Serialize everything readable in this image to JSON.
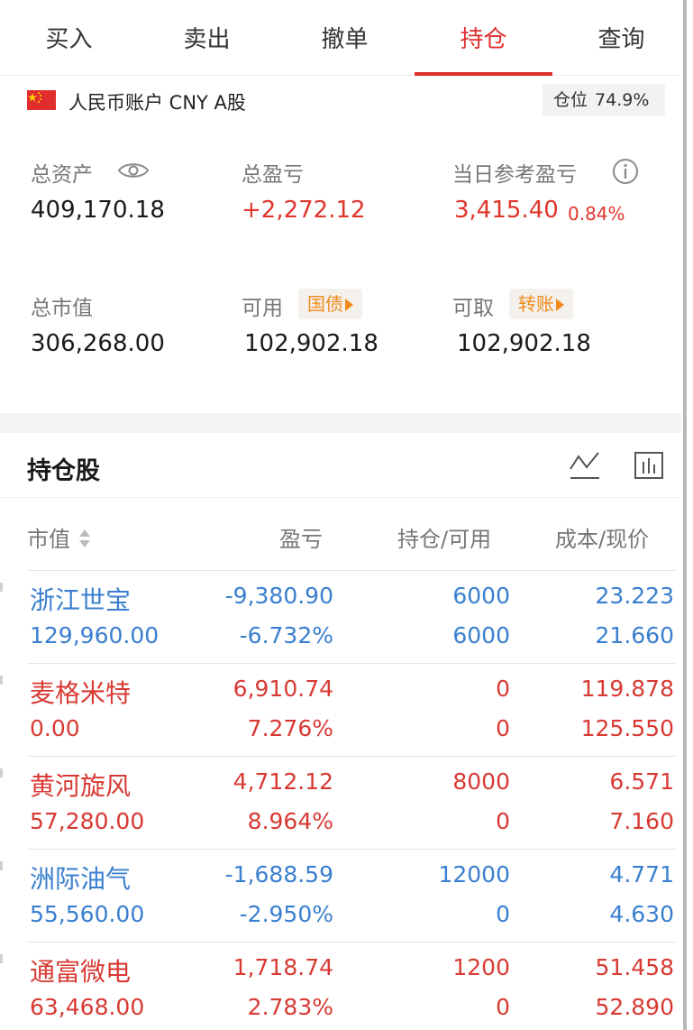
{
  "tabs": [
    {
      "label": "买入",
      "active": false
    },
    {
      "label": "卖出",
      "active": false
    },
    {
      "label": "撤单",
      "active": false
    },
    {
      "label": "持仓",
      "active": true
    },
    {
      "label": "查询",
      "active": false
    }
  ],
  "account": {
    "label": "人民币账户 CNY A股",
    "position_label": "仓位",
    "position_value": "74.9%"
  },
  "summary": {
    "total_assets_label": "总资产",
    "total_assets": "409,170.18",
    "total_pl_label": "总盈亏",
    "total_pl": "+2,272.12",
    "daily_pl_label": "当日参考盈亏",
    "daily_pl": "3,415.40",
    "daily_pl_pct": "0.84%",
    "market_value_label": "总市值",
    "market_value": "306,268.00",
    "available_label": "可用",
    "available": "102,902.18",
    "bond_badge": "国债",
    "withdrawable_label": "可取",
    "withdrawable": "102,902.18",
    "transfer_badge": "转账"
  },
  "holdings": {
    "title": "持仓股",
    "columns": {
      "market_value": "市值",
      "pl": "盈亏",
      "position": "持仓/可用",
      "cost_price": "成本/现价"
    },
    "rows": [
      {
        "name": "浙江世宝",
        "market_value": "129,960.00",
        "pl": "-9,380.90",
        "pl_pct": "-6.732%",
        "position": "6000",
        "available": "6000",
        "cost": "23.223",
        "price": "21.660",
        "color": "#3a7fcf"
      },
      {
        "name": "麦格米特",
        "market_value": "0.00",
        "pl": "6,910.74",
        "pl_pct": "7.276%",
        "position": "0",
        "available": "0",
        "cost": "119.878",
        "price": "125.550",
        "color": "#d83a33"
      },
      {
        "name": "黄河旋风",
        "market_value": "57,280.00",
        "pl": "4,712.12",
        "pl_pct": "8.964%",
        "position": "8000",
        "available": "0",
        "cost": "6.571",
        "price": "7.160",
        "color": "#d83a33"
      },
      {
        "name": "洲际油气",
        "market_value": "55,560.00",
        "pl": "-1,688.59",
        "pl_pct": "-2.950%",
        "position": "12000",
        "available": "0",
        "cost": "4.771",
        "price": "4.630",
        "color": "#3a7fcf"
      },
      {
        "name": "通富微电",
        "market_value": "63,468.00",
        "pl": "1,718.74",
        "pl_pct": "2.783%",
        "position": "1200",
        "available": "0",
        "cost": "51.458",
        "price": "52.890",
        "color": "#d83a33"
      }
    ]
  },
  "colors": {
    "accent": "#e02e2e",
    "gain": "#d83a33",
    "loss": "#3a7fcf",
    "badge": "#f08a1c"
  },
  "icons": [
    "eye-icon",
    "info-icon",
    "line-chart-icon",
    "bar-chart-icon",
    "sort-icon",
    "china-flag-icon"
  ]
}
